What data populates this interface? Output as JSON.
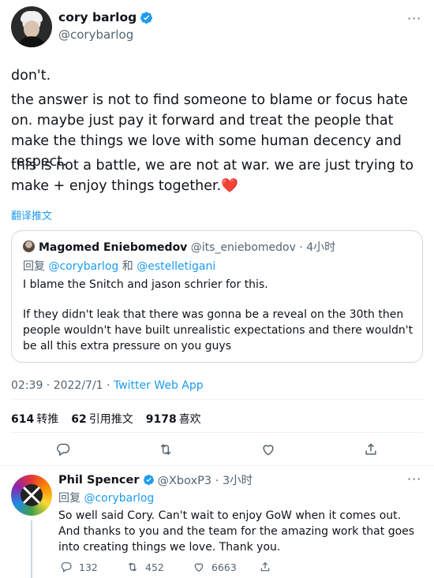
{
  "author": {
    "display_name": "cory barlog",
    "handle": "@corybarlog"
  },
  "tweet": {
    "paragraphs": [
      "don't.",
      "the answer is not to find someone to blame or focus hate on. maybe just pay it forward and treat the people that make the things we love with some human decency and respect.",
      "this is not a battle, we are not at war. we are just trying to make + enjoy things together.❤️"
    ],
    "translate_label": "翻译推文"
  },
  "quote": {
    "display_name": "Magomed Eniebomedov",
    "handle_time": "@its_eniebomedov · 4小时",
    "reply_prefix": "回复",
    "reply_to_1": "@corybarlog",
    "reply_joiner": "和",
    "reply_to_2": "@estelletigani",
    "text_1": "I blame the Snitch and jason schrier for this.",
    "text_2": "If they didn't leak that there was gonna be a reveal on the 30th then people wouldn't have built unrealistic expectations and there wouldn't be all this extra pressure on you guys"
  },
  "meta": {
    "timestamp": "02:39 · 2022/7/1 · ",
    "client": "Twitter Web App"
  },
  "stats": {
    "retweets_count": "614",
    "retweets_label": "转推",
    "quotes_count": "62",
    "quotes_label": "引用推文",
    "likes_count": "9178",
    "likes_label": "喜欢"
  },
  "actions": {
    "icons": [
      "reply-icon",
      "retweet-icon",
      "like-icon",
      "share-icon"
    ]
  },
  "reply": {
    "display_name": "Phil Spencer",
    "handle_time": "@XboxP3 · 3小时",
    "reply_prefix": "回复",
    "reply_to": "@corybarlog",
    "text": "So well said Cory. Can't wait to enjoy GoW when it comes out. And thanks to you and the team for the amazing work that goes into creating things we love. Thank you.",
    "reply_count": "132",
    "retweet_count": "452",
    "like_count": "6663"
  },
  "colors": {
    "accent": "#1d9bf0",
    "muted": "#536471",
    "text": "#0f1419",
    "like_heart": "#f91880"
  }
}
